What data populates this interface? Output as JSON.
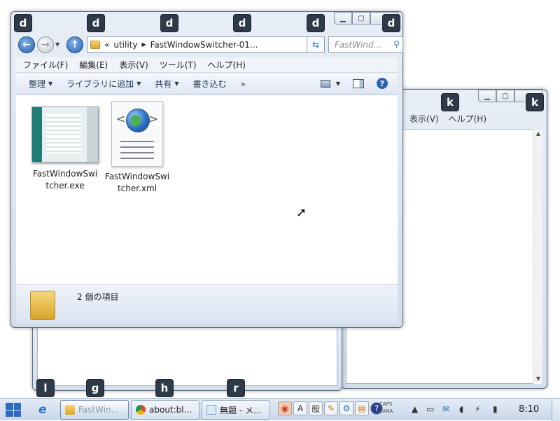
{
  "hints": {
    "explorer": [
      "d",
      "d",
      "d",
      "d",
      "d",
      "d"
    ],
    "back_window": [
      "k",
      "k"
    ],
    "taskbar": [
      "l",
      "g",
      "h",
      "r"
    ]
  },
  "back_window": {
    "menu": [
      "表示(V)",
      "ヘルプ(H)"
    ]
  },
  "explorer": {
    "address_prefix": "«",
    "address_parts": [
      "utility",
      "FastWindowSwitcher-01..."
    ],
    "search_placeholder": "FastWind...",
    "menu": [
      "ファイル(F)",
      "編集(E)",
      "表示(V)",
      "ツール(T)",
      "ヘルプ(H)"
    ],
    "commands": [
      "整理",
      "ライブラリに追加",
      "共有",
      "書き込む",
      "»"
    ],
    "files": [
      {
        "name_line1": "FastWindowSwi",
        "name_line2": "tcher.exe"
      },
      {
        "name_line1": "FastWindowSwi",
        "name_line2": "tcher.xml"
      }
    ],
    "status": "2 個の項目"
  },
  "taskbar": {
    "tasks": [
      "FastWin...",
      "about:bl...",
      "無題 - メ..."
    ],
    "caps": "CAPS",
    "kana": "KANA",
    "ime": "般",
    "clock": "8:10"
  }
}
